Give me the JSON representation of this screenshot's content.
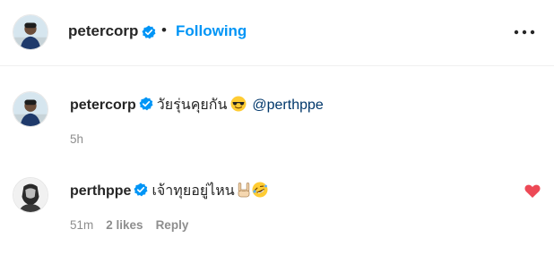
{
  "header": {
    "username": "petercorp",
    "separator": "•",
    "follow_status": "Following",
    "more_icon": "more-horizontal-icon"
  },
  "comments": [
    {
      "username": "petercorp",
      "text": "วัยรุ่นคุยกัน",
      "emojis": [
        "sunglasses-face-emoji"
      ],
      "mention": "@perthppe",
      "time": "5h",
      "liked": false
    },
    {
      "username": "perthppe",
      "text": "เจ้าทุยอยู่ไหน",
      "emojis": [
        "sign-of-horns-emoji",
        "rofl-face-emoji"
      ],
      "time": "51m",
      "likes": "2 likes",
      "reply": "Reply",
      "liked": true
    }
  ],
  "colors": {
    "accent": "#0095f6",
    "verified": "#0095f6",
    "mention": "#00376b",
    "heart": "#ed4956",
    "meta": "#8e8e8e"
  }
}
